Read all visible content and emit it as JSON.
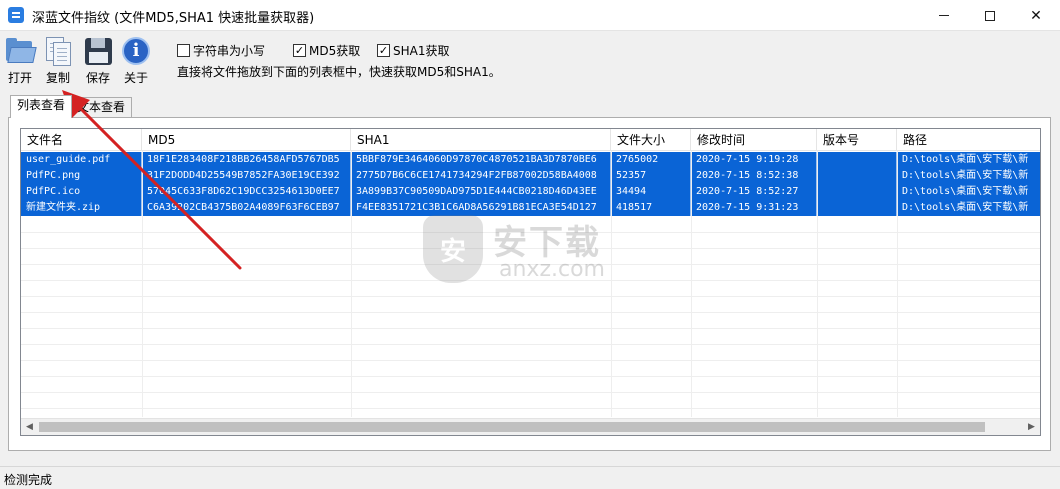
{
  "window": {
    "title": "深蓝文件指纹 (文件MD5,SHA1 快速批量获取器)",
    "close_glyph": "✕"
  },
  "toolbar": {
    "open_label": "打开",
    "copy_label": "复制",
    "save_label": "保存",
    "about_label": "关于",
    "about_glyph": "i"
  },
  "options": {
    "lowercase": {
      "label": "字符串为小写",
      "checked": false
    },
    "md5": {
      "label": "MD5获取",
      "checked": true
    },
    "sha1": {
      "label": "SHA1获取",
      "checked": true
    },
    "check_glyph": "✓",
    "hint": "直接将文件拖放到下面的列表框中，快速获取MD5和SHA1。"
  },
  "tabs": [
    {
      "label": "列表查看",
      "active": true
    },
    {
      "label": "文本查看",
      "active": false
    }
  ],
  "table": {
    "columns": [
      "文件名",
      "MD5",
      "SHA1",
      "文件大小",
      "修改时间",
      "版本号",
      "路径"
    ],
    "rows": [
      [
        "user_guide.pdf",
        "18F1E283408F218BB26458AFD5767DB5",
        "5BBF879E3464060D97870C4870521BA3D7870BE6",
        "2765002",
        "2020-7-15 9:19:28",
        "",
        "D:\\tools\\桌面\\安下载\\新"
      ],
      [
        "PdfPC.png",
        "31F2DODD4D25549B7852FA30E19CE392",
        "2775D7B6C6CE1741734294F2FB87002D58BA4008",
        "52357",
        "2020-7-15 8:52:38",
        "",
        "D:\\tools\\桌面\\安下载\\新"
      ],
      [
        "PdfPC.ico",
        "57045C633F8D62C19DCC3254613D0EE7",
        "3A899B37C90509DAD975D1E444CB0218D46D43EE",
        "34494",
        "2020-7-15 8:52:27",
        "",
        "D:\\tools\\桌面\\安下载\\新"
      ],
      [
        "新建文件夹.zip",
        "C6A39202CB4375B02A4089F63F6CEB97",
        "F4EE8351721C3B1C6AD8A56291B81ECA3E54D127",
        "418517",
        "2020-7-15 9:31:23",
        "",
        "D:\\tools\\桌面\\安下载\\新"
      ]
    ]
  },
  "watermark": {
    "shield_text": "安",
    "cn_text": "安下载",
    "en_text": "anxz.com"
  },
  "status": {
    "text": "检测完成"
  },
  "colors": {
    "selection": "#0a64d6",
    "annotation_arrow": "#d42222"
  }
}
